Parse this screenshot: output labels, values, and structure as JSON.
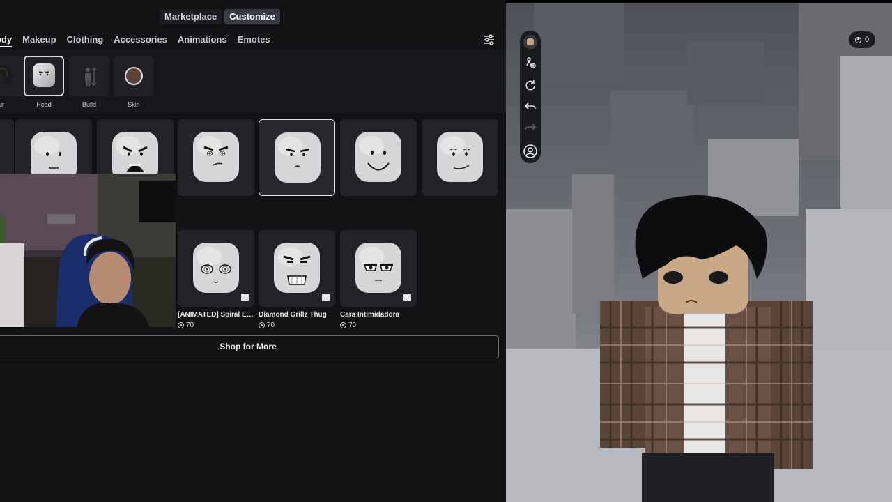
{
  "header": {
    "tabs": [
      {
        "label": "Marketplace",
        "active": false
      },
      {
        "label": "Customize",
        "active": true
      }
    ]
  },
  "categories": [
    {
      "label": "ody",
      "active": true
    },
    {
      "label": "Makeup",
      "active": false
    },
    {
      "label": "Clothing",
      "active": false
    },
    {
      "label": "Accessories",
      "active": false
    },
    {
      "label": "Animations",
      "active": false
    },
    {
      "label": "Emotes",
      "active": false
    }
  ],
  "filter_icon": "sliders-icon",
  "subcategories": [
    {
      "label": "air",
      "icon": "hair-icon",
      "selected": false
    },
    {
      "label": "Head",
      "icon": "head-icon",
      "selected": true
    },
    {
      "label": "Build",
      "icon": "build-icon",
      "selected": false
    },
    {
      "label": "Skin",
      "icon": "skin-icon",
      "selected": false
    }
  ],
  "items_row1": [
    {
      "face": "neutral",
      "selected": false
    },
    {
      "face": "shouting",
      "selected": false
    },
    {
      "face": "smirk-brows",
      "selected": false
    },
    {
      "face": "frown-brows",
      "selected": true
    },
    {
      "face": "big-smile",
      "selected": false
    },
    {
      "face": "slight-smile",
      "selected": false
    }
  ],
  "items_row2": [
    {
      "name": "[ANIMATED] Spiral Ey...",
      "price": "70",
      "face": "spiral"
    },
    {
      "name": "Diamond Grillz Thug",
      "price": "70",
      "face": "grillz"
    },
    {
      "name": "Cara Intimidadora",
      "price": "70",
      "face": "intimidating"
    }
  ],
  "shop_more_label": "Shop for More",
  "viewport": {
    "currency": "0",
    "tools": [
      "avatar-thumb-icon",
      "adjust-icon",
      "rotate-icon",
      "undo-icon",
      "redo-icon",
      "avatar-view-icon"
    ]
  },
  "colors": {
    "panel_bg": "#121215",
    "card_bg": "#222329",
    "accent_selected": "#e6e6e9",
    "scene_bg": "#7a7c83"
  }
}
